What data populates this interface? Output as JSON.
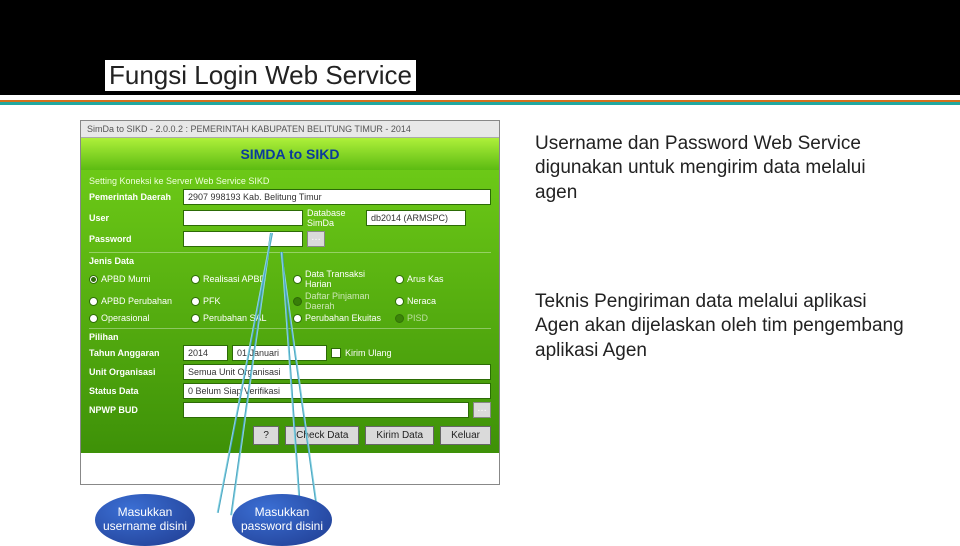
{
  "slide": {
    "title": "Fungsi Login Web Service"
  },
  "text": {
    "p1": "Username dan Password Web Service digunakan untuk mengirim data melalui agen",
    "p2": "Teknis Pengiriman data melalui aplikasi Agen akan dijelaskan oleh tim pengembang aplikasi Agen"
  },
  "app": {
    "titlebar": "SimDa to SIKD - 2.0.0.2 : PEMERINTAH KABUPATEN BELITUNG TIMUR - 2014",
    "hero": "SIMDA to SIKD",
    "section_conn": "Setting Koneksi ke Server Web Service SIKD",
    "pemda_label": "Pemerintah Daerah",
    "pemda_value": "2907 998193 Kab. Belitung Timur",
    "user_label": "User",
    "db_label": "Database SimDa",
    "db_value": "db2014 (ARMSPC)",
    "pwd_label": "Password",
    "jenis_label": "Jenis Data",
    "radios": {
      "r1": "APBD Murni",
      "r2": "Realisasi APBD",
      "r3": "Data Transaksi Harian",
      "r4": "Arus Kas",
      "r5": "APBD Perubahan",
      "r6": "PFK",
      "r7": "Daftar Pinjaman Daerah",
      "r8": "Neraca",
      "r9": "Operasional",
      "r10": "Perubahan SAL",
      "r11": "Perubahan Ekuitas",
      "r12": "PISD"
    },
    "pilihan_label": "Pilihan",
    "tahun_label": "Tahun Anggaran",
    "tahun_value": "2014",
    "bulan_value": "01 Januari",
    "kirim_ulang": "Kirim Ulang",
    "unit_label": "Unit Organisasi",
    "unit_value": "Semua Unit Organisasi",
    "status_label": "Status Data",
    "status_value": "0 Belum Siap Verifikasi",
    "npwp_label": "NPWP BUD",
    "btn_q": "?",
    "btn_check": "Check Data",
    "btn_kirim": "Kirim Data",
    "btn_keluar": "Keluar"
  },
  "callouts": {
    "c1": "Masukkan username disini",
    "c2": "Masukkan password disini"
  }
}
